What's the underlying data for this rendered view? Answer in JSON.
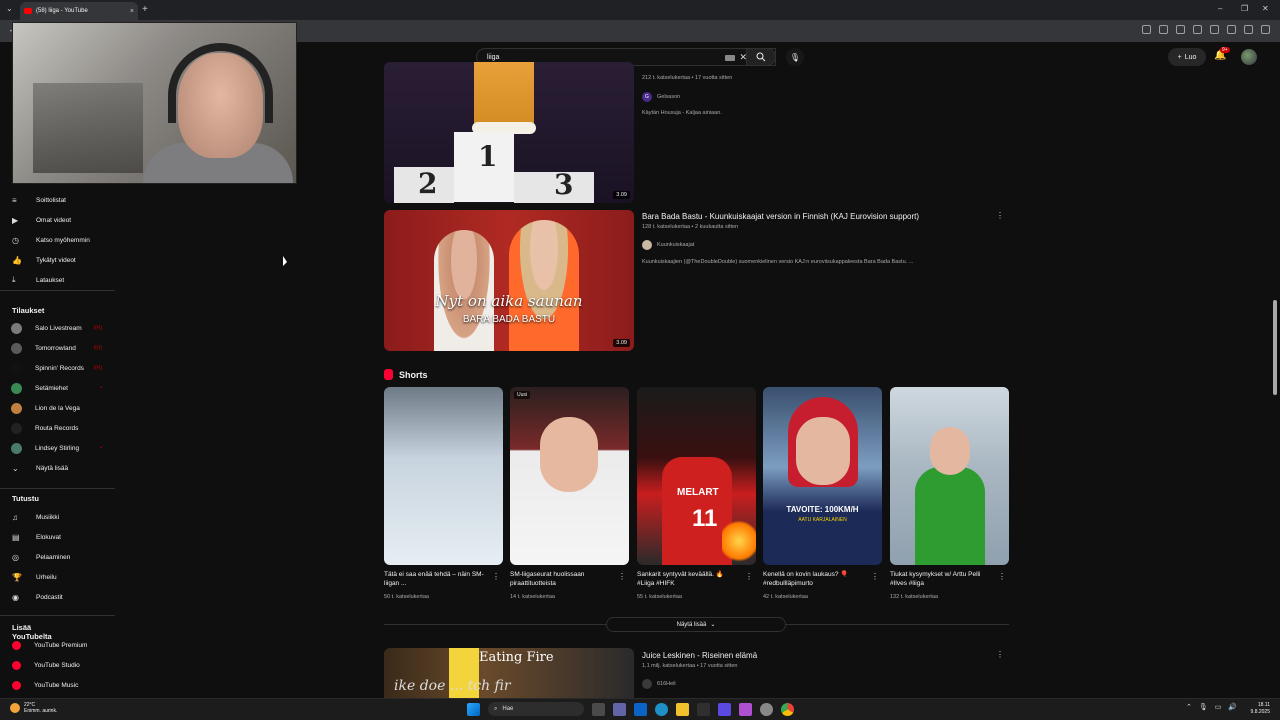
{
  "browser": {
    "tab_title": "(58) liiga - YouTube",
    "new_tab": "+",
    "tab_close": "×"
  },
  "header": {
    "search_value": "liiga",
    "create_label": "Luo",
    "notifications_count": "9+"
  },
  "sidebar": {
    "you_items": [
      {
        "icon": "playlist-icon",
        "glyph": "≡",
        "label": "Soittolistat"
      },
      {
        "icon": "your-videos-icon",
        "glyph": "▶",
        "label": "Omat videot"
      },
      {
        "icon": "watch-later-icon",
        "glyph": "◷",
        "label": "Katso myöhemmin"
      },
      {
        "icon": "liked-videos-icon",
        "glyph": "👍",
        "label": "Tykätyt videot"
      },
      {
        "icon": "downloads-icon",
        "glyph": "⤓",
        "label": "Lataukset"
      }
    ],
    "subscriptions_heading": "Tilaukset",
    "subscriptions": [
      {
        "label": "Salo Livestream",
        "color": "#7a7a7a",
        "indicator": "((•))"
      },
      {
        "label": "Tomorrowland",
        "color": "#5a5a5a",
        "indicator": "((•))"
      },
      {
        "label": "Spinnin' Records",
        "color": "#111111",
        "indicator": "((•))"
      },
      {
        "label": "Setämiehet",
        "color": "#3a8a55",
        "indicator": "•"
      },
      {
        "label": "Lion de la Vega",
        "color": "#c08040",
        "indicator": ""
      },
      {
        "label": "Routa Records",
        "color": "#222222",
        "indicator": ""
      },
      {
        "label": "Lindsey Stirling",
        "color": "#4a7a6a",
        "indicator": "•"
      }
    ],
    "show_more": "Näytä lisää",
    "explore_heading": "Tutustu",
    "explore": [
      {
        "icon": "music-icon",
        "glyph": "♫",
        "label": "Musiikki"
      },
      {
        "icon": "movies-icon",
        "glyph": "▤",
        "label": "Elokuvat"
      },
      {
        "icon": "gaming-icon",
        "glyph": "◎",
        "label": "Pelaaminen"
      },
      {
        "icon": "sports-icon",
        "glyph": "🏆",
        "label": "Urheilu"
      },
      {
        "icon": "podcasts-icon",
        "glyph": "◉",
        "label": "Podcastit"
      }
    ],
    "more_heading": "Lisää YouTubelta",
    "more": [
      {
        "label": "YouTube Premium",
        "color": "#ff0033"
      },
      {
        "label": "YouTube Studio",
        "color": "#ff0033"
      },
      {
        "label": "YouTube Music",
        "color": "#ff0033"
      }
    ]
  },
  "results": {
    "video1": {
      "meta": "212 t. katselukertaa • 17 vuotta sitten",
      "channel": "Gelsason",
      "channel_initial": "G",
      "description": "Käytän Housuja - Kaljaa ainiaan.",
      "duration": "3.09"
    },
    "video2": {
      "title": "Bara Bada Bastu - Kuunkuiskaajat version in Finnish (KAJ Eurovision support)",
      "meta": "128 t. katselukertaa • 2 kuukautta sitten",
      "channel": "Kuunkuiskaajat",
      "description": "Kuunkuiskaajien (@TheDoubleDouble) suomenkielinen versio KAJ:n euroviisukappaleesta Bara Bada Bastu. ...",
      "duration": "3.09",
      "overlay_line1": "Nyt on aika saunan",
      "overlay_line2": "BARA BADA BASTU"
    },
    "shorts_heading": "Shorts",
    "shorts": [
      {
        "title": "Tätä ei saa enää tehdä – näin SM-liigan ...",
        "views": "50 t. katselukertaa"
      },
      {
        "title": "SM-liigaseurat huolissaan piraattituotteista",
        "views": "14 t. katselukertaa",
        "badge": "Uusi"
      },
      {
        "title": "Sankarit syntyvät keväällä. 🔥 #Liiga #HIFK",
        "views": "55 t. katselukertaa",
        "jersey_number": "11",
        "jersey_name": "MELART"
      },
      {
        "title": "Kenellä on kovin laukaus? 🎈 #redbullläpimurto",
        "views": "42 t. katselukertaa",
        "caption": "TAVOITE: 100KM/H",
        "caption_sub": "AATU KARJALAINEN"
      },
      {
        "title": "Tiukat kysymykset w/ Arttu Pelli #Ilves #liiga",
        "views": "132 t. katselukertaa"
      }
    ],
    "shorts_show_more": "Näytä lisää",
    "video3": {
      "title": "Juice Leskinen - Riseinen elämä",
      "meta": "1,1 milj. katselukertaa • 17 vuotta sitten",
      "channel": "616Heli",
      "thumb_caption": "Eating Fire",
      "thumb_caption2": "ike doe ... tch fir"
    }
  },
  "taskbar": {
    "temp": "22°C",
    "weather": "Enimm. aurink.",
    "search": "Hae",
    "time": "18.11",
    "date": "9.8.2025"
  }
}
